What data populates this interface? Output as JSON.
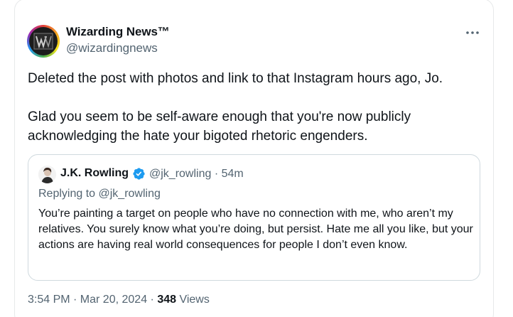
{
  "author": {
    "display_name": "Wizarding News™",
    "handle": "@wizardingnews",
    "avatar_icon": "wizarding-news-logo"
  },
  "tweet": {
    "paragraphs": [
      "Deleted the post with photos and link to that Instagram hours ago, Jo.",
      "Glad you seem to be self-aware enough that you're now publicly acknowledging the hate your bigoted rhetoric engenders."
    ]
  },
  "quoted": {
    "display_name": "J.K. Rowling",
    "verified": true,
    "handle_time": "@jk_rowling · 54m",
    "replying_prefix": "Replying to ",
    "replying_handle": "@jk_rowling",
    "text": "You’re painting a target on people who have no connection with me, who aren’t my relatives. You surely know what you’re doing, but persist. Hate me all you like, but your actions are having real world consequences for people I don’t even know."
  },
  "meta": {
    "time_date": "3:54 PM · Mar 20, 2024 · ",
    "views_count": "348",
    "views_label": " Views"
  },
  "colors": {
    "text_primary": "#0f1419",
    "text_secondary": "#536471",
    "border": "#cfd9de",
    "verified_blue": "#1d9bf0"
  }
}
